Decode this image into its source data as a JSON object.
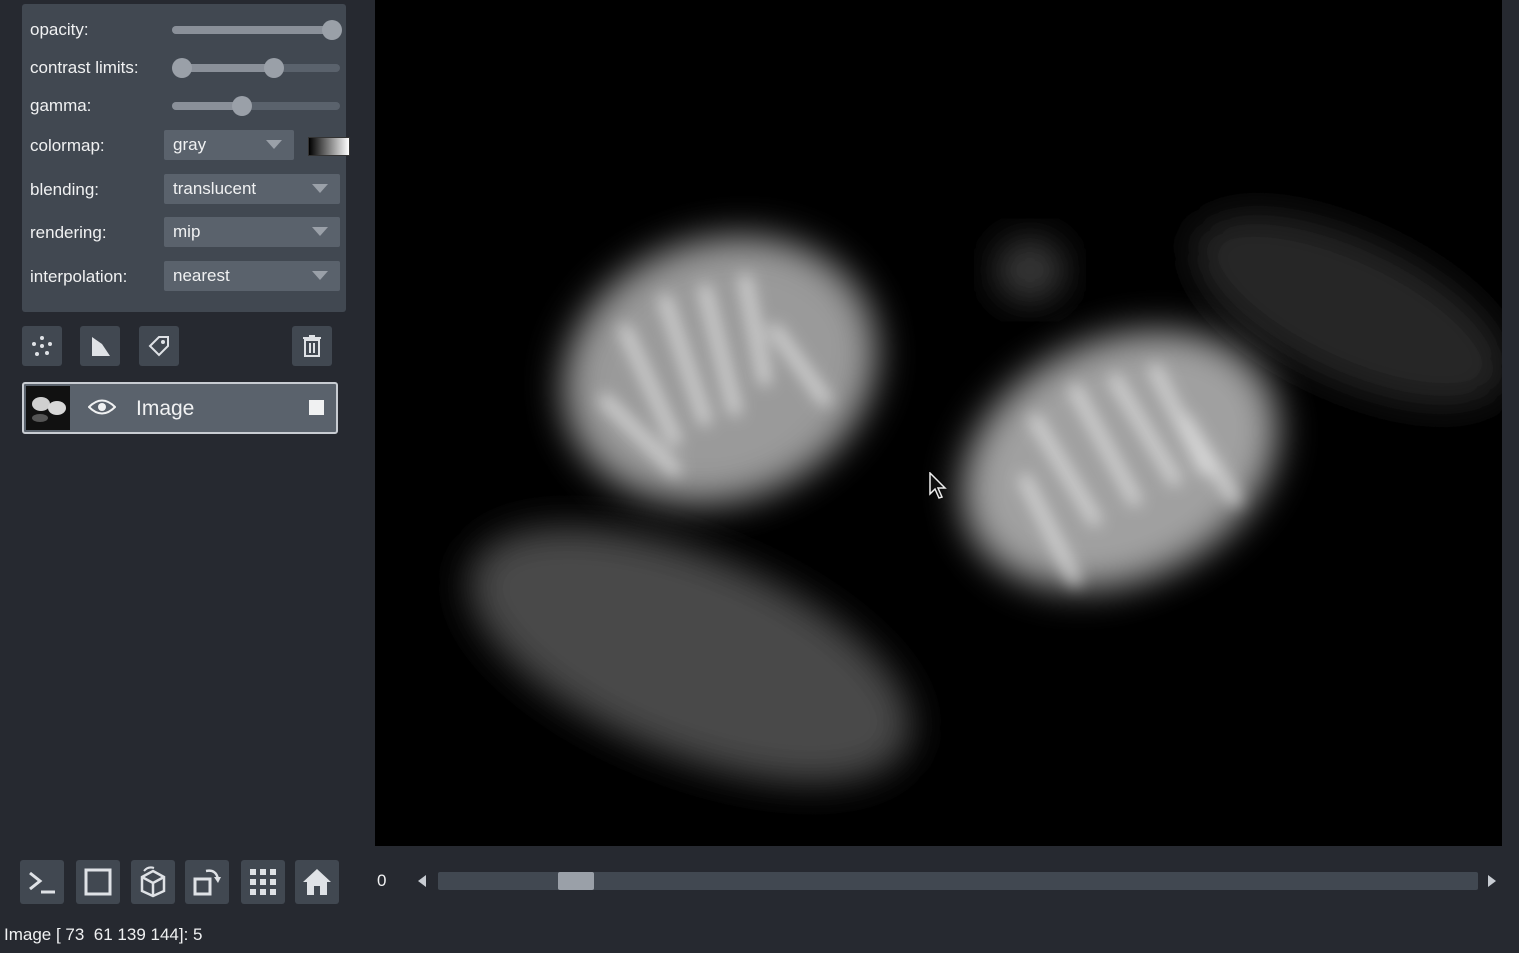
{
  "layer_controls": {
    "opacity": {
      "label": "opacity:",
      "value": 1.0
    },
    "contrast_limits": {
      "label": "contrast limits:",
      "low": 0.0,
      "high": 0.6
    },
    "gamma": {
      "label": "gamma:",
      "value": 0.4
    },
    "colormap": {
      "label": "colormap:",
      "value": "gray"
    },
    "blending": {
      "label": "blending:",
      "value": "translucent"
    },
    "rendering": {
      "label": "rendering:",
      "value": "mip"
    },
    "interpolation": {
      "label": "interpolation:",
      "value": "nearest"
    }
  },
  "layer_buttons": [
    "new-points-icon",
    "new-shapes-icon",
    "new-labels-icon",
    "delete-layer-icon"
  ],
  "layers": [
    {
      "name": "Image",
      "visible": true,
      "selected": true
    }
  ],
  "viewer_buttons": [
    "console-icon",
    "ndisplay-icon",
    "roll-dims-icon",
    "transpose-icon",
    "grid-icon",
    "home-icon"
  ],
  "dims": {
    "frame": "0",
    "slider_position": 0.13
  },
  "status": "Image [ 73  61 139 144]: 5",
  "colors": {
    "background": "#262930",
    "panel": "#414851",
    "control": "#5a626c",
    "text": "#f0f1f2"
  }
}
